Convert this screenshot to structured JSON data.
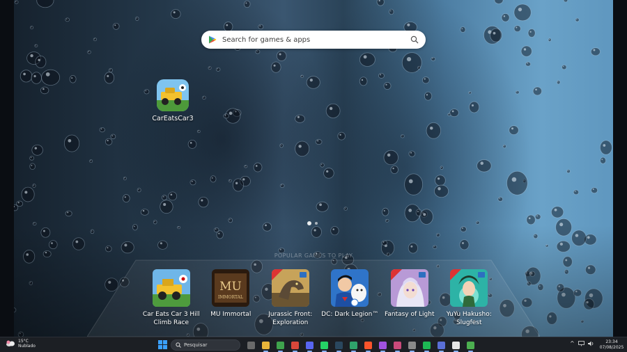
{
  "search": {
    "placeholder": "Search for games & apps",
    "icon": "google-play-icon"
  },
  "desktop_shortcut": {
    "label": "CarEatsCar3",
    "icon": "car-eats-car-icon"
  },
  "pages": {
    "count": 2,
    "current": 1
  },
  "popular": {
    "title": "POPULAR GAMES TO PLAY",
    "games": [
      {
        "name": "Car Eats Car 3 Hill Climb Race",
        "color": "#6fb6e8"
      },
      {
        "name": "MU Immortal",
        "color": "#5a3a1e"
      },
      {
        "name": "Jurassic Front: Exploration",
        "color": "#c7a35a"
      },
      {
        "name": "DC: Dark Legion™",
        "color": "#2f74c9"
      },
      {
        "name": "Fantasy of Light",
        "color": "#b89ad6"
      },
      {
        "name": "YuYu Hakusho: Slugfest",
        "color": "#2db3a6"
      }
    ]
  },
  "taskbar": {
    "weather": {
      "temp": "15°C",
      "condition": "Nublado"
    },
    "search_label": "Pesquisar",
    "apps": [
      {
        "name": "widgets",
        "color": "#6a6a6a"
      },
      {
        "name": "file-explorer",
        "color": "#e9b53a"
      },
      {
        "name": "chrome",
        "color": "#3fa34d"
      },
      {
        "name": "chrome-profile",
        "color": "#d9473a"
      },
      {
        "name": "discord",
        "color": "#5865f2"
      },
      {
        "name": "whatsapp",
        "color": "#25d366"
      },
      {
        "name": "steam",
        "color": "#2a475e"
      },
      {
        "name": "green-app",
        "color": "#2fa36b"
      },
      {
        "name": "brave",
        "color": "#fb542b"
      },
      {
        "name": "messenger",
        "color": "#a052e0"
      },
      {
        "name": "tool",
        "color": "#c94a7a"
      },
      {
        "name": "github",
        "color": "#8a8a8a"
      },
      {
        "name": "spotify",
        "color": "#1db954"
      },
      {
        "name": "app-shortcut",
        "color": "#5a6fd6"
      },
      {
        "name": "calendar",
        "color": "#e6e6e6"
      },
      {
        "name": "google-play-games",
        "color": "#4caf50"
      }
    ],
    "time": "23:34",
    "date": "07/08/2025"
  }
}
